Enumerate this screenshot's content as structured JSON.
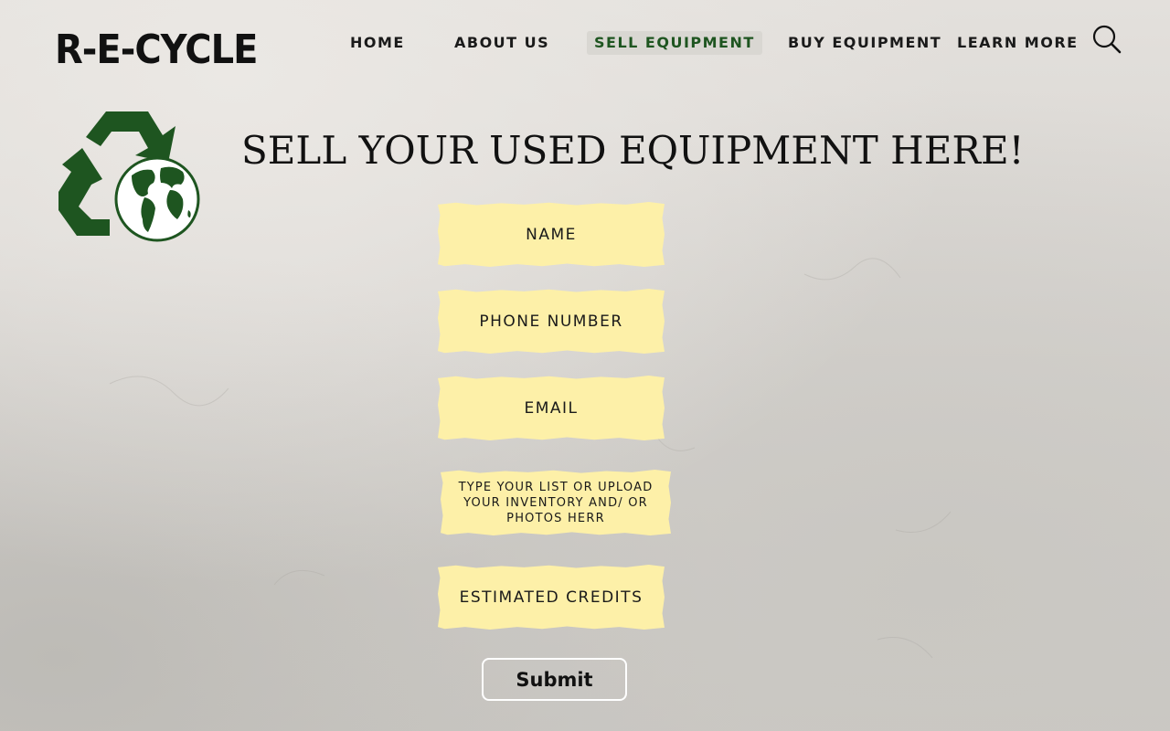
{
  "brand": {
    "logo_text": "R-E-CYCLE"
  },
  "nav": {
    "items": [
      {
        "label": "HOME"
      },
      {
        "label": "ABOUT US"
      },
      {
        "label": "SELL  EQUIPMENT",
        "active": true
      },
      {
        "label": "BUY EQUIPMENT"
      },
      {
        "label": "LEARN MORE"
      }
    ],
    "search_icon": "search-icon",
    "active_color": "#1e5520"
  },
  "emblem": {
    "icon": "recycle-globe-icon",
    "color": "#1e5520"
  },
  "page": {
    "headline": "SELL YOUR USED EQUIPMENT HERE!"
  },
  "form": {
    "fields": [
      {
        "label": "NAME"
      },
      {
        "label": "PHONE NUMBER"
      },
      {
        "label": "EMAIL"
      },
      {
        "label": "TYPE YOUR LIST OR UPLOAD YOUR INVENTORY AND/ OR PHOTOS HERR"
      },
      {
        "label": "ESTIMATED CREDITS"
      }
    ],
    "field_color": "#fdf0a8",
    "submit_label": "Submit"
  }
}
